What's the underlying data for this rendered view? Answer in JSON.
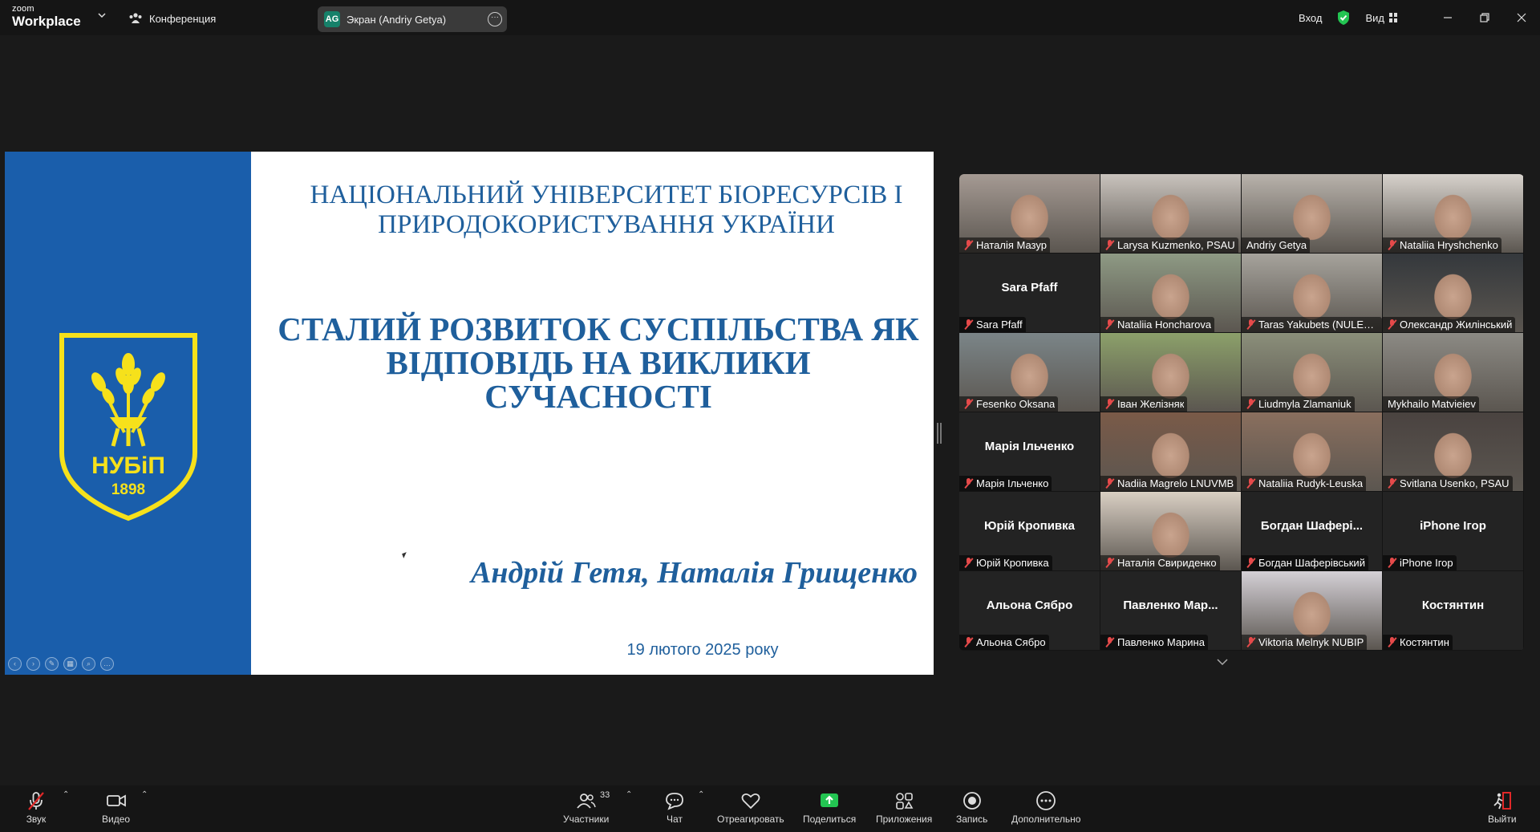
{
  "app": {
    "logo_small": "zoom",
    "logo_big": "Workplace",
    "conference_label": "Конференция",
    "screen_share_badge": "AG",
    "screen_share_label": "Экран (Andriy Getya)",
    "login_label": "Вход",
    "view_label": "Вид",
    "accent_color": "#0b5cff",
    "active_speaker_color": "#2dbe6c"
  },
  "slide": {
    "title": "НАЦІОНАЛЬНИЙ УНІВЕРСИТЕТ БІОРЕСУРСІВ І ПРИРОДОКОРИСТУВАННЯ УКРАЇНИ",
    "subtitle": "СТАЛИЙ РОЗВИТОК СУСПІЛЬСТВА ЯК ВІДПОВІДЬ НА ВИКЛИКИ СУЧАСНОСТІ",
    "authors": "Андрій Гетя, Наталія Грищенко",
    "date": "19 лютого  2025 року",
    "crest_name": "НУБіП",
    "crest_year": "1898",
    "brand_blue": "#1a5eab",
    "brand_yellow": "#f6e11b"
  },
  "participants": [
    {
      "name": "Наталія Мазур",
      "video": true,
      "muted": true,
      "bg": "#a59a93"
    },
    {
      "name": "Larysa Kuzmenko, PSAU",
      "video": true,
      "muted": true,
      "bg": "#c9c3bd"
    },
    {
      "name": "Andriy Getya",
      "video": true,
      "muted": false,
      "bg": "#b8b2ab"
    },
    {
      "name": "Nataliia Hryshchenko",
      "video": true,
      "muted": true,
      "bg": "#d7d2cc"
    },
    {
      "name": "Sara Pfaff",
      "display": "Sara Pfaff",
      "video": false,
      "muted": true
    },
    {
      "name": "Nataliia Honcharova",
      "video": true,
      "muted": true,
      "bg": "#8e9a84"
    },
    {
      "name": "Taras Yakubets (NULES ...",
      "video": true,
      "muted": true,
      "bg": "#a6a39c"
    },
    {
      "name": "Олександр Жилінський",
      "video": true,
      "muted": true,
      "bg": "#34383c"
    },
    {
      "name": "Fesenko Oksana",
      "video": true,
      "muted": true,
      "bg": "#7b8588"
    },
    {
      "name": "Іван Желізняк",
      "video": true,
      "muted": true,
      "bg": "#8ca06a"
    },
    {
      "name": "Liudmyla Zlamaniuk",
      "video": true,
      "muted": true,
      "bg": "#8b8f7a"
    },
    {
      "name": "Mykhailo Matvieiev",
      "video": true,
      "muted": false,
      "bg": "#8c8a84",
      "active": true
    },
    {
      "name": "Марія Ільченко",
      "display": "Марія Ільченко",
      "video": false,
      "muted": true
    },
    {
      "name": "Nadiia Magrelo LNUVMB",
      "video": true,
      "muted": true,
      "bg": "#7a5a48"
    },
    {
      "name": "Nataliia Rudyk-Leuska",
      "video": true,
      "muted": true,
      "bg": "#8a6f5e"
    },
    {
      "name": "Svitlana Usenko, PSAU",
      "video": true,
      "muted": true,
      "bg": "#4a4340"
    },
    {
      "name": "Юрій Кропивка",
      "display": "Юрій Кропивка",
      "video": false,
      "muted": true
    },
    {
      "name": "Наталія Свириденко",
      "video": true,
      "muted": true,
      "bg": "#d9cfc3"
    },
    {
      "name": "Богдан Шаферівський",
      "display": "Богдан  Шафері...",
      "video": false,
      "muted": true
    },
    {
      "name": "iPhone Ігор",
      "display": "iPhone Ігор",
      "video": false,
      "muted": true
    },
    {
      "name": "Альона Сябро",
      "display": "Альона Сябро",
      "video": false,
      "muted": true
    },
    {
      "name": "Павленко Марина",
      "display": "Павленко  Мар...",
      "video": false,
      "muted": true
    },
    {
      "name": "Viktoria Melnyk NUBIP",
      "video": true,
      "muted": true,
      "bg": "#d4d0d6"
    },
    {
      "name": "Костянтин",
      "display": "Костянтин",
      "video": false,
      "muted": true
    }
  ],
  "toolbar": {
    "audio": "Звук",
    "video": "Видео",
    "participants": "Участники",
    "participants_count": "33",
    "chat": "Чат",
    "react": "Отреагировать",
    "share": "Поделиться",
    "apps": "Приложения",
    "record": "Запись",
    "more": "Дополнительно",
    "leave": "Выйти",
    "share_color": "#23c552",
    "leave_color": "#e02828"
  }
}
